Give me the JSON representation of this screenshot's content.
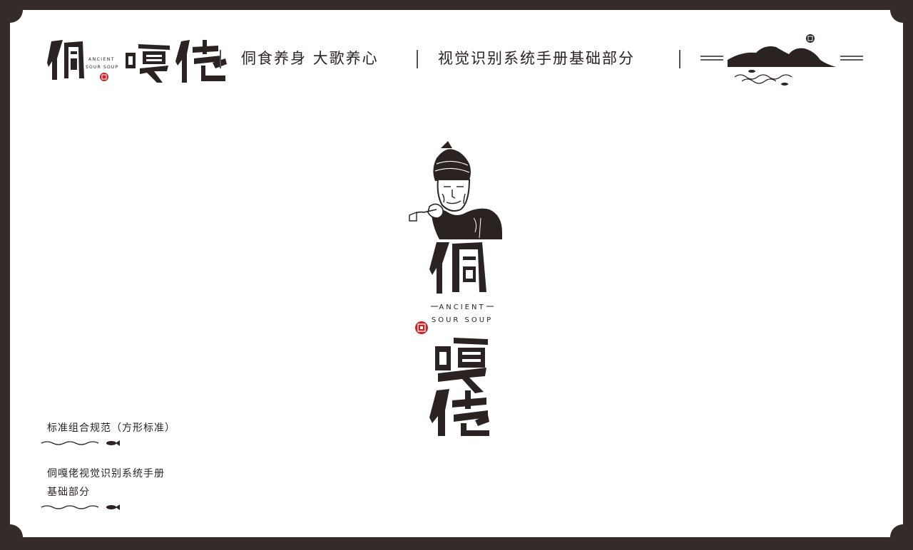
{
  "header": {
    "brand_en_line1": "ANCIENT",
    "brand_en_line2": "SOUR SOUP",
    "slogan": "侗食养身 大歌养心",
    "manual_title": "视觉识别系统手册基础部分"
  },
  "logo": {
    "en_line1": "ANCIENT",
    "en_line2": "SOUR SOUP"
  },
  "captions": {
    "spec_label": "标准组合规范（方形标准）",
    "manual_line1": "侗嘎佬视觉识别系统手册",
    "manual_line2": "基础部分"
  },
  "colors": {
    "frame": "#332c2b",
    "ink": "#2b2322",
    "seal": "#c0272d",
    "paper": "#ffffff"
  }
}
